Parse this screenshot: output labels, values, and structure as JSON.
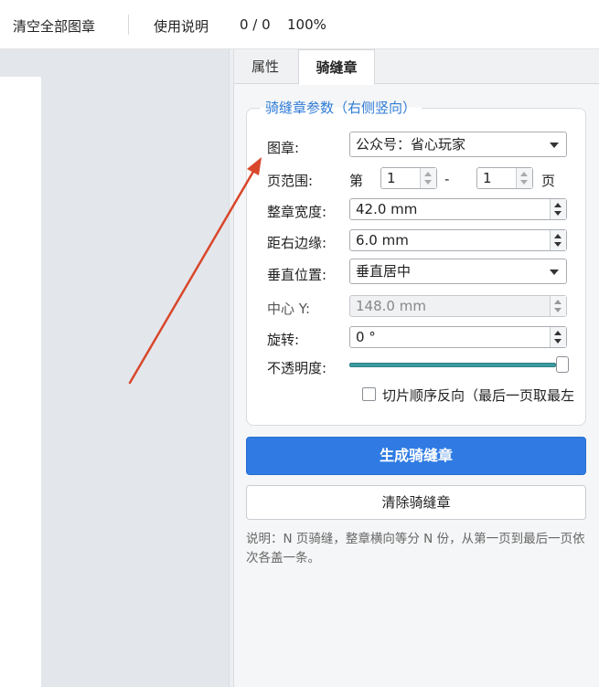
{
  "toolbar": {
    "clear_all_label": "清空全部图章",
    "help_label": "使用说明",
    "page_counter": "0 / 0",
    "zoom": "100%"
  },
  "tabs": [
    {
      "label": "属性",
      "active": false
    },
    {
      "label": "骑缝章",
      "active": true
    }
  ],
  "group": {
    "title": "骑缝章参数（右侧竖向）",
    "stamp": {
      "label": "图章:",
      "value": "公众号：省心玩家"
    },
    "page_range": {
      "label": "页范围:",
      "prefix": "第",
      "from": "1",
      "dash": "-",
      "to": "1",
      "suffix": "页"
    },
    "width": {
      "label": "整章宽度:",
      "value": "42.0 mm"
    },
    "right_margin": {
      "label": "距右边缘:",
      "value": "6.0 mm"
    },
    "vertical_pos": {
      "label": "垂直位置:",
      "value": "垂直居中"
    },
    "center_y": {
      "label": "中心 Y:",
      "value": "148.0 mm",
      "enabled": false
    },
    "rotation": {
      "label": "旋转:",
      "value": "0 °"
    },
    "opacity": {
      "label": "不透明度:",
      "level": 1.0
    },
    "reverse_order": {
      "label": "切片顺序反向（最后一页取最左",
      "checked": false
    }
  },
  "actions": {
    "generate_label": "生成骑缝章",
    "clear_label": "清除骑缝章"
  },
  "note": "说明：N 页骑缝，整章横向等分 N 份，从第一页到最后一页依次各盖一条。",
  "colors": {
    "accent": "#2f7be3",
    "group_title": "#2f7bd6",
    "slider": "#3a9aa0",
    "annotation_arrow": "#d9472b"
  }
}
